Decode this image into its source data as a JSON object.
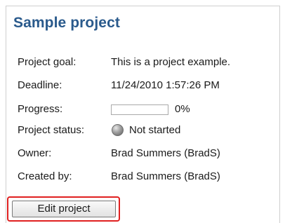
{
  "project": {
    "title": "Sample project",
    "fields": {
      "goal": {
        "label": "Project goal:",
        "value": "This is a project example."
      },
      "deadline": {
        "label": "Deadline:",
        "value": "11/24/2010 1:57:26 PM"
      },
      "progress": {
        "label": "Progress:",
        "value": 0,
        "value_text": "0%"
      },
      "status": {
        "label": "Project status:",
        "value": "Not started",
        "icon": "status-not-started-icon"
      },
      "owner": {
        "label": "Owner:",
        "value": "Brad Summers (BradS)"
      },
      "created_by": {
        "label": "Created by:",
        "value": "Brad Summers (BradS)"
      }
    },
    "edit_button_label": "Edit project"
  },
  "colors": {
    "title": "#2a5a8c",
    "highlight": "#e02020",
    "progress_fill": "#3b7bd4"
  }
}
